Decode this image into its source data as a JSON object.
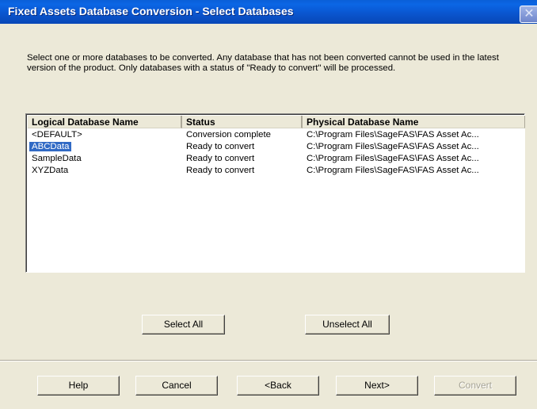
{
  "window": {
    "title": "Fixed Assets Database Conversion - Select Databases",
    "close_glyph": "✕"
  },
  "description": "Select one or more databases to be converted. Any database that has not been converted cannot be used in the latest version of the product. Only databases with a status of \"Ready to convert\" will be processed.",
  "table": {
    "columns": [
      "Logical Database Name",
      "Status",
      "Physical Database Name"
    ],
    "rows": [
      {
        "logical": "<DEFAULT>",
        "status": "Conversion complete",
        "physical": "C:\\Program Files\\SageFAS\\FAS Asset Ac..."
      },
      {
        "logical": "ABCData",
        "status": "Ready to convert",
        "physical": "C:\\Program Files\\SageFAS\\FAS Asset Ac..."
      },
      {
        "logical": "SampleData",
        "status": "Ready to convert",
        "physical": "C:\\Program Files\\SageFAS\\FAS Asset Ac..."
      },
      {
        "logical": "XYZData",
        "status": "Ready to convert",
        "physical": "C:\\Program Files\\SageFAS\\FAS Asset Ac..."
      }
    ],
    "selected_row": "ABCData"
  },
  "buttons": {
    "select_all": "Select All",
    "unselect_all": "Unselect All",
    "help": "Help",
    "cancel": "Cancel",
    "back": "<Back",
    "next": "Next>",
    "convert": "Convert"
  },
  "colors": {
    "titlebar": "#0a56d0",
    "dialog_bg": "#ece9d8",
    "selection": "#316ac5"
  }
}
